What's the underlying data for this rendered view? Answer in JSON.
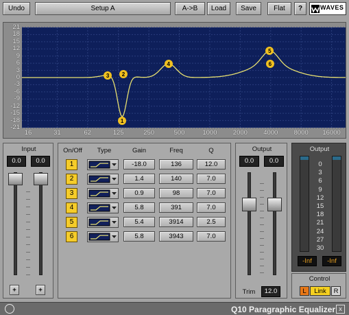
{
  "toolbar": {
    "undo": "Undo",
    "setup": "Setup A",
    "ab": "A->B",
    "load": "Load",
    "save": "Save",
    "flat": "Flat",
    "help": "?",
    "brand": "WAVES"
  },
  "graph": {
    "y_ticks": [
      "21",
      "18",
      "15",
      "12",
      "9",
      "6",
      "3",
      "0",
      "-3",
      "-6",
      "-9",
      "-12",
      "-15",
      "-18",
      "-21"
    ],
    "x_ticks": [
      "16",
      "31",
      "62",
      "125",
      "250",
      "500",
      "1000",
      "2000",
      "4000",
      "8000",
      "16000"
    ],
    "markers": [
      "1",
      "2",
      "3",
      "4",
      "5",
      "6"
    ]
  },
  "input": {
    "title": "Input",
    "left": "0.0",
    "right": "0.0",
    "plus_left": "+",
    "plus_right": "+"
  },
  "bands": {
    "headers": {
      "onoff": "On/Off",
      "type": "Type",
      "gain": "Gain",
      "freq": "Freq",
      "q": "Q"
    },
    "rows": [
      {
        "n": "1",
        "gain": "-18.0",
        "freq": "136",
        "q": "12.0"
      },
      {
        "n": "2",
        "gain": "1.4",
        "freq": "140",
        "q": "7.0"
      },
      {
        "n": "3",
        "gain": "0.9",
        "freq": "98",
        "q": "7.0"
      },
      {
        "n": "4",
        "gain": "5.8",
        "freq": "391",
        "q": "7.0"
      },
      {
        "n": "5",
        "gain": "5.4",
        "freq": "3914",
        "q": "2.5"
      },
      {
        "n": "6",
        "gain": "5.8",
        "freq": "3943",
        "q": "7.0"
      }
    ]
  },
  "output": {
    "title": "Output",
    "left": "0.0",
    "right": "0.0",
    "trim_label": "Trim",
    "trim_value": "12.0"
  },
  "meters": {
    "title": "Output",
    "scale": [
      "0",
      "3",
      "6",
      "9",
      "12",
      "15",
      "18",
      "21",
      "24",
      "27",
      "30"
    ],
    "left": "-Inf",
    "right": "-Inf",
    "control_title": "Control",
    "control_l": "L",
    "control_link": "Link",
    "control_r": "R"
  },
  "footer": {
    "title": "Q10 Paragraphic Equalizer",
    "close": "x"
  },
  "colors": {
    "graph_bg": "#0e1f5a",
    "curve": "#e8e070",
    "marker": "#f0c020",
    "band_number": "#f5cc2a"
  }
}
